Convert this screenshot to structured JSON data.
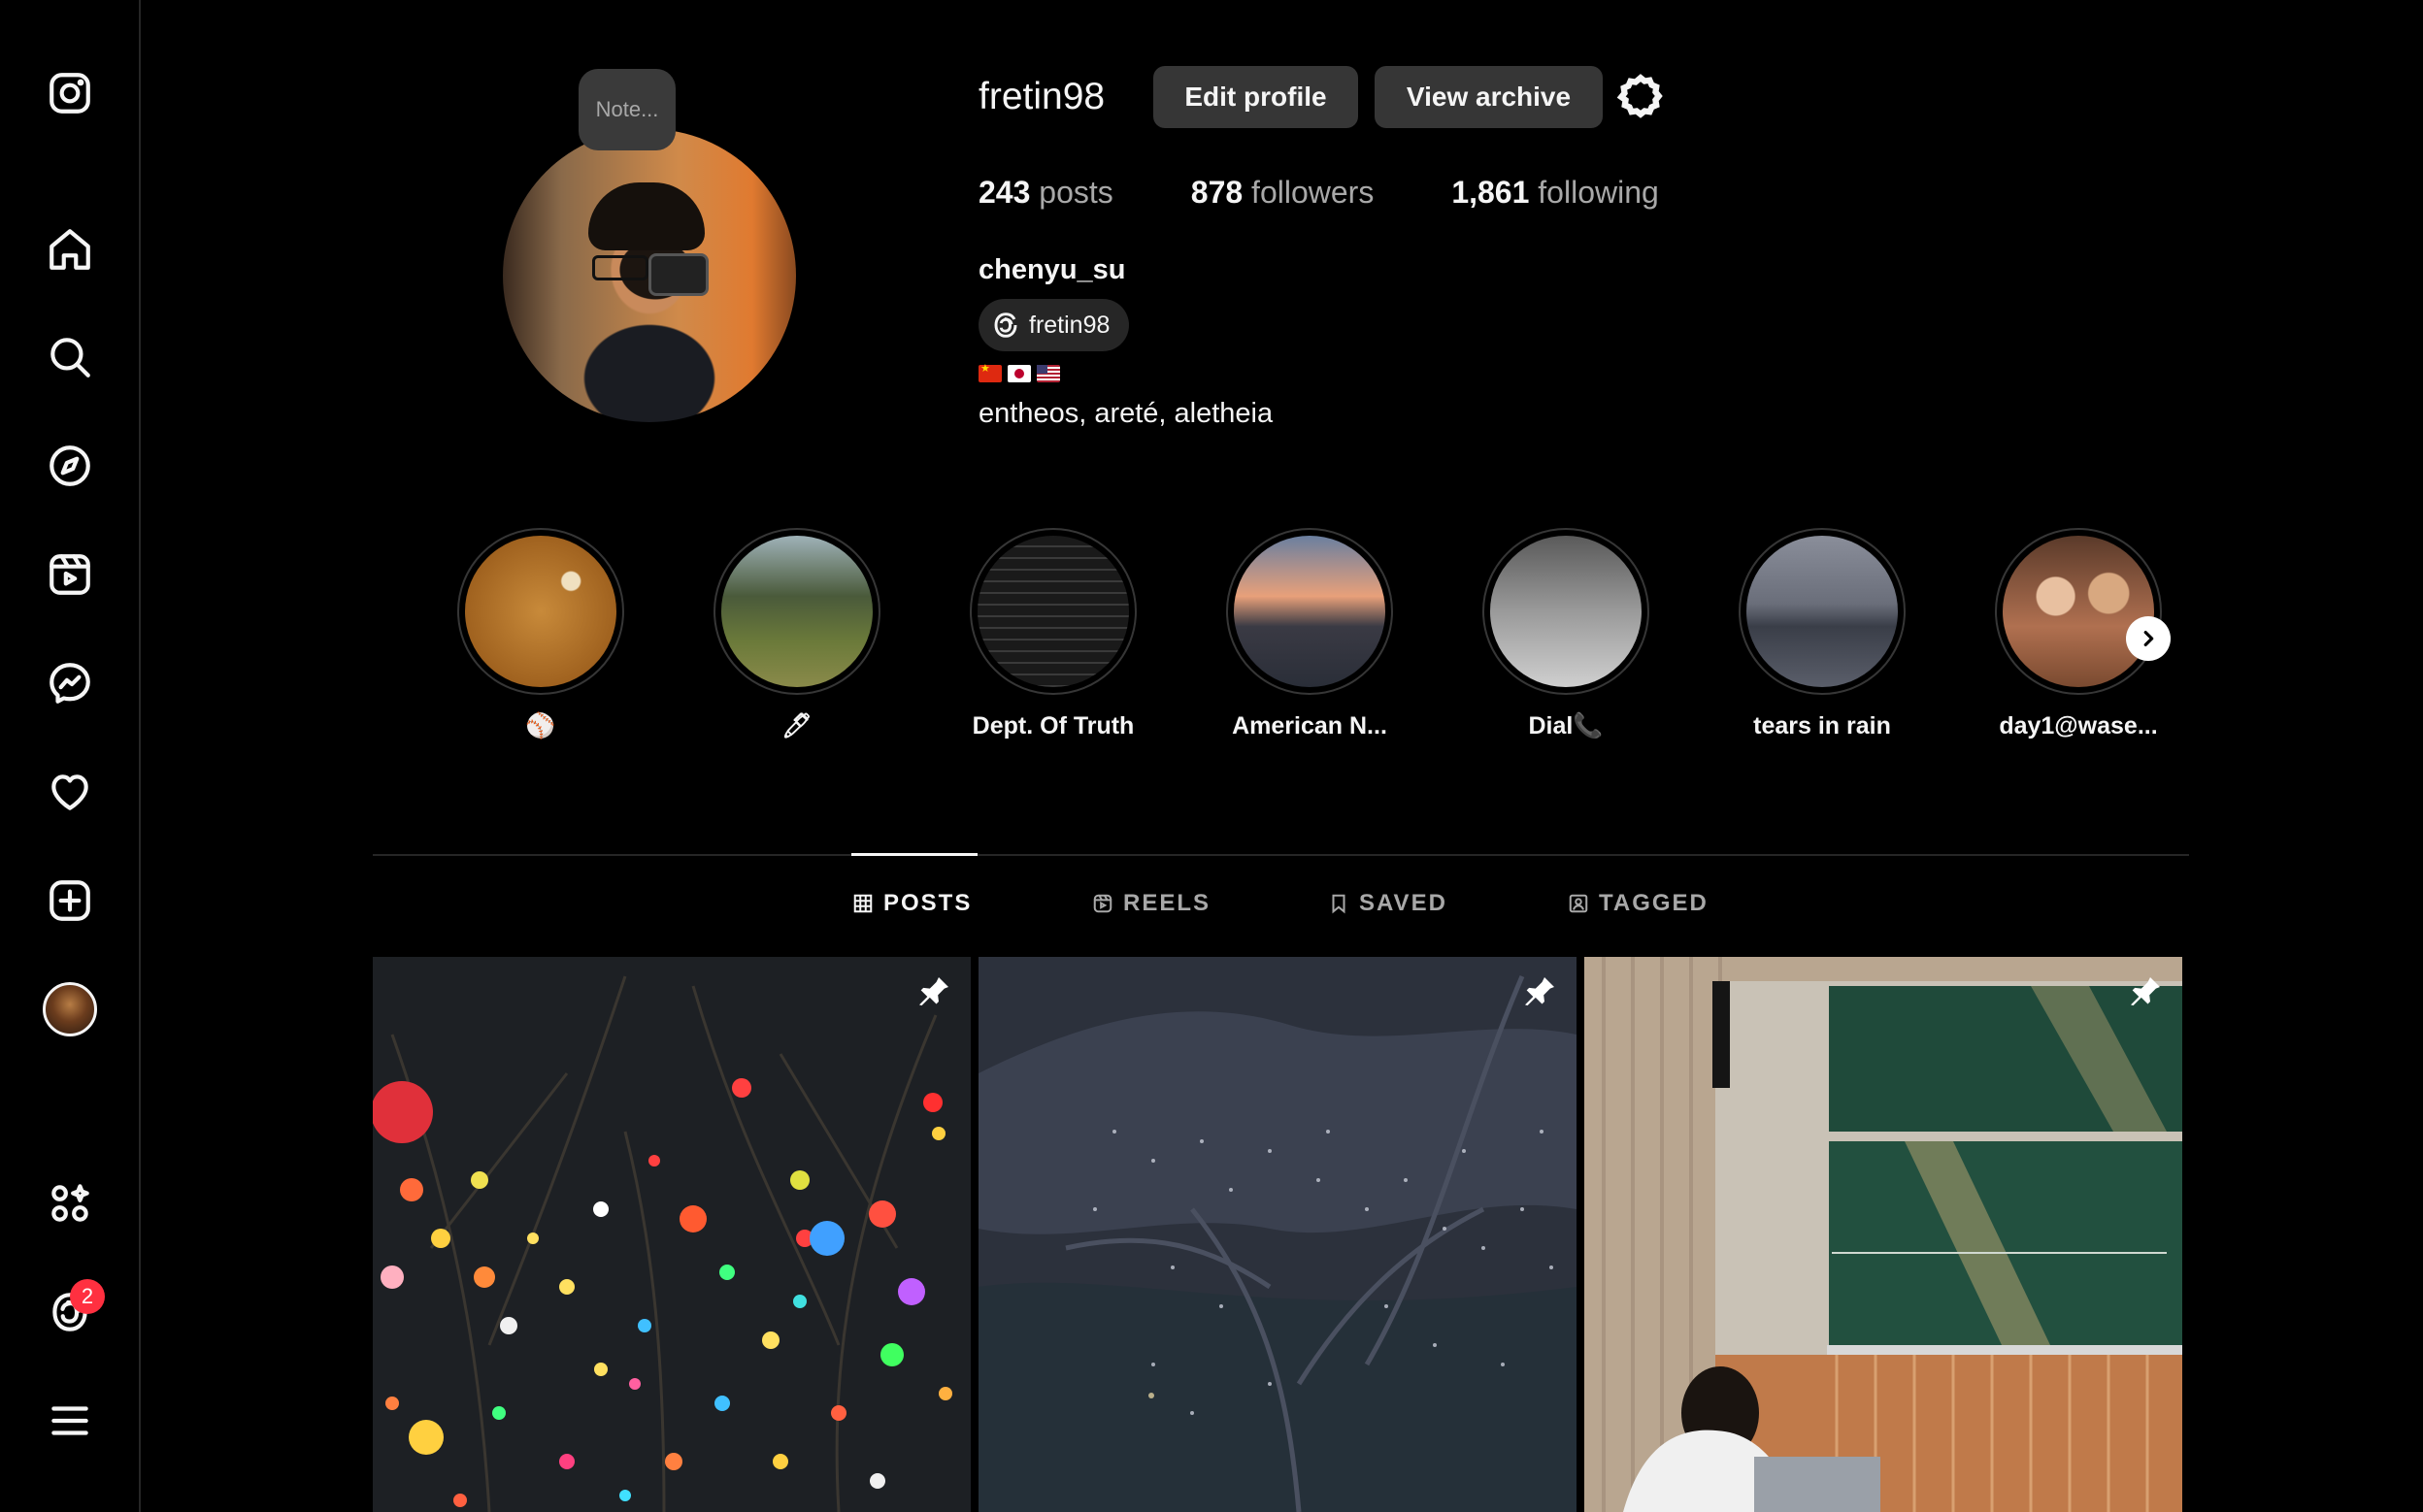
{
  "sidebar": {
    "items": [
      {
        "name": "instagram-logo-icon"
      },
      {
        "name": "home-icon"
      },
      {
        "name": "search-icon"
      },
      {
        "name": "explore-icon"
      },
      {
        "name": "reels-icon"
      },
      {
        "name": "messenger-icon"
      },
      {
        "name": "heart-icon"
      },
      {
        "name": "create-icon"
      },
      {
        "name": "profile-avatar"
      },
      {
        "name": "also-from-meta-icon"
      },
      {
        "name": "threads-icon"
      },
      {
        "name": "menu-icon"
      }
    ],
    "threads_badge": "2"
  },
  "profile": {
    "note_label": "Note...",
    "username": "fretin98",
    "edit_profile_label": "Edit profile",
    "view_archive_label": "View archive",
    "stats": {
      "posts_count": "243",
      "posts_label": "posts",
      "followers_count": "878",
      "followers_label": "followers",
      "following_count": "1,861",
      "following_label": "following"
    },
    "full_name": "chenyu_su",
    "threads_handle": "fretin98",
    "bio": "entheos, areté, aletheia"
  },
  "highlights": [
    {
      "label": "⚾",
      "color": "#b8752a"
    },
    {
      "label": "🖊",
      "color": "#6e7a4a"
    },
    {
      "label": "Dept. Of Truth",
      "color": "#1a1a1a"
    },
    {
      "label": "American N...",
      "color": "#c9846a"
    },
    {
      "label": "Dial📞",
      "color": "#7a7a7a"
    },
    {
      "label": "tears in rain",
      "color": "#6e7280"
    },
    {
      "label": "day1@wase...",
      "color": "#b07050"
    }
  ],
  "tabs": [
    {
      "label": "POSTS",
      "active": true
    },
    {
      "label": "REELS",
      "active": false
    },
    {
      "label": "SAVED",
      "active": false
    },
    {
      "label": "TAGGED",
      "active": false
    }
  ],
  "posts": [
    {
      "pinned": true
    },
    {
      "pinned": true
    },
    {
      "pinned": true
    }
  ]
}
